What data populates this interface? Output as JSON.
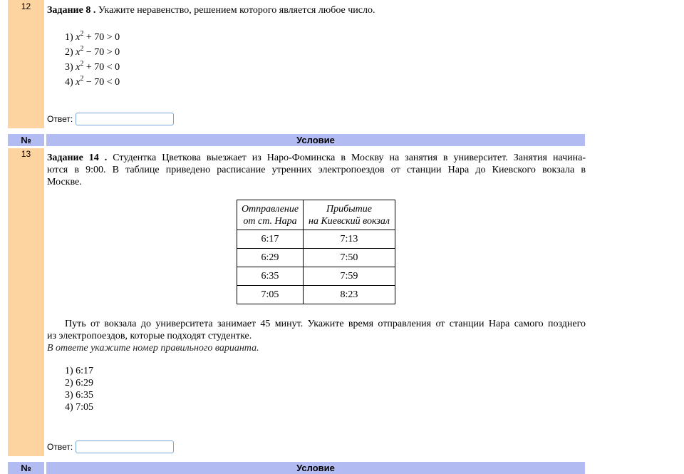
{
  "task12": {
    "number": "12",
    "title": "Задание 8 .",
    "text": "Укажите неравенство, решением которого является любое число.",
    "options": [
      {
        "n": "1)",
        "var": "x",
        "exp": "2",
        "rest": " + 70 > 0"
      },
      {
        "n": "2)",
        "var": "x",
        "exp": "2",
        "rest": " − 70 > 0"
      },
      {
        "n": "3)",
        "var": "x",
        "exp": "2",
        "rest": " + 70 < 0"
      },
      {
        "n": "4)",
        "var": "x",
        "exp": "2",
        "rest": " − 70 < 0"
      }
    ],
    "answer_label": "Ответ:"
  },
  "header": {
    "num": "№",
    "cond": "Условие"
  },
  "task13": {
    "number": "13",
    "title": "Задание 14 .",
    "text_line1": "Студентка Цветкова выезжает из Наро-Фоминска в Москву на занятия в университет. Занятия начина-",
    "text_line2": "ются в 9:00. В таблице приведено расписание утренних электропоездов от станции Нара до Киевского вокзала в",
    "text_line3": "Москве.",
    "table_head": {
      "col1_l1": "Отправление",
      "col1_l2": "от ст. Нара",
      "col2_l1": "Прибытие",
      "col2_l2": "на Киевский вокзал"
    },
    "rows": [
      {
        "dep": "6:17",
        "arr": "7:13"
      },
      {
        "dep": "6:29",
        "arr": "7:50"
      },
      {
        "dep": "6:35",
        "arr": "7:59"
      },
      {
        "dep": "7:05",
        "arr": "8:23"
      }
    ],
    "para_line1": "Путь от вокзала до университета занимает 45 минут. Укажите время отправления от станции Нара самого позднего",
    "para_line2": "из электропоездов, которые подходят студентке.",
    "instruction": "В ответе укажите номер правильного варианта.",
    "options": [
      "1) 6:17",
      "2) 6:29",
      "3) 6:35",
      "4) 7:05"
    ],
    "answer_label": "Ответ:"
  },
  "footer_header": {
    "num": "№",
    "cond": "Условие"
  }
}
